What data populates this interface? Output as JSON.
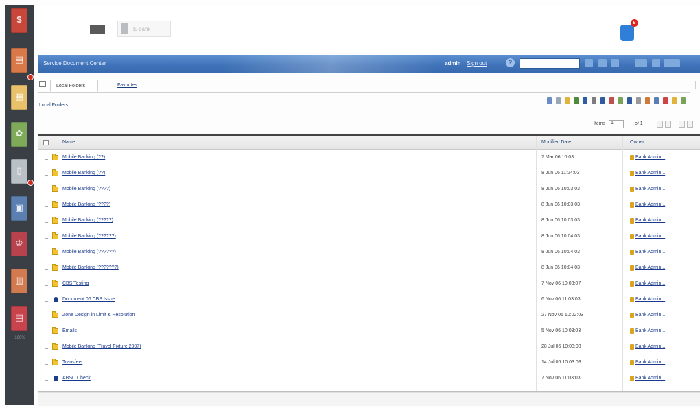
{
  "colors": {
    "dock_bg": "#3a3f46",
    "blue_bar": "#3f72b8",
    "link": "#1a3a8c",
    "badge": "#d0291b"
  },
  "dock": {
    "tiles": [
      {
        "name": "dock-tile-1",
        "color": "#c9463a",
        "glyph": "$"
      },
      {
        "name": "dock-tile-2",
        "color": "#d9794a",
        "glyph": "▤"
      },
      {
        "name": "dock-tile-3",
        "color": "#e9c16a",
        "glyph": "▦"
      },
      {
        "name": "dock-tile-4",
        "color": "#7faa5a",
        "glyph": "✿"
      },
      {
        "name": "dock-tile-5",
        "color": "#b9c1c7",
        "glyph": "▯"
      },
      {
        "name": "dock-tile-6",
        "color": "#5b7fb0",
        "glyph": "▣"
      },
      {
        "name": "dock-tile-7",
        "color": "#b9434c",
        "glyph": "♔"
      },
      {
        "name": "dock-tile-8",
        "color": "#d27a50",
        "glyph": "▥"
      },
      {
        "name": "dock-tile-9",
        "color": "#c8434c",
        "glyph": "▤"
      }
    ],
    "label": "100%"
  },
  "header": {
    "doc_label": "E-bank",
    "notification_count": "9"
  },
  "bluebar": {
    "site_name": "Service Document Center",
    "user_name": "admin",
    "user_link": "Sign out",
    "search_placeholder": ""
  },
  "tabs": [
    {
      "label": "Local Folders",
      "active": true
    },
    {
      "label": "Favorites",
      "active": false
    }
  ],
  "breadcrumb": "Local Folders",
  "pager": {
    "label": "Items",
    "value": "1",
    "of_text": "of 1"
  },
  "table": {
    "columns": {
      "name": "Name",
      "modified": "Modified Date",
      "owner": "Owner"
    },
    "rows": [
      {
        "icon": "folder",
        "name": "Mobile Banking (??)",
        "date": "7 Mar 06 10:03",
        "owner": "Bank Admin..."
      },
      {
        "icon": "folder",
        "name": "Mobile Banking (??)",
        "date": "8 Jun 06 11:24:03",
        "owner": "Bank Admin..."
      },
      {
        "icon": "folder",
        "name": "Mobile Banking (????)",
        "date": "8 Jun 06 10:03:03",
        "owner": "Bank Admin..."
      },
      {
        "icon": "folder",
        "name": "Mobile Banking (????)",
        "date": "8 Jun 06 10:03:03",
        "owner": "Bank Admin..."
      },
      {
        "icon": "folder",
        "name": "Mobile Banking (?????)",
        "date": "8 Jun 06 10:03:03",
        "owner": "Bank Admin..."
      },
      {
        "icon": "folder",
        "name": "Mobile Banking (??????)",
        "date": "8 Jun 06 10:04:03",
        "owner": "Bank Admin..."
      },
      {
        "icon": "folder",
        "name": "Mobile Banking (??????)",
        "date": "8 Jun 06 10:04:03",
        "owner": "Bank Admin..."
      },
      {
        "icon": "folder",
        "name": "Mobile Banking (???????)",
        "date": "8 Jun 06 10:04:03",
        "owner": "Bank Admin..."
      },
      {
        "icon": "folder",
        "name": "CBS Testing",
        "date": "7 Nov 06 10:03:07",
        "owner": "Bank Admin..."
      },
      {
        "icon": "doc",
        "name": "Document 06 CBS Issue",
        "date": "6 Nov 06 11:03:03",
        "owner": "Bank Admin..."
      },
      {
        "icon": "folder",
        "name": "Zone Design in Limit & Resolution",
        "date": "27 Nov 06 10:02:03",
        "owner": "Bank Admin..."
      },
      {
        "icon": "folder",
        "name": "Emails",
        "date": "5 Nov 06 10:03:03",
        "owner": "Bank Admin..."
      },
      {
        "icon": "folder",
        "name": "Mobile Banking (Travel Fixture 2007)",
        "date": "28 Jul 06 10:03:03",
        "owner": "Bank Admin..."
      },
      {
        "icon": "folder",
        "name": "Transfers",
        "date": "14 Jul 06 10:03:03",
        "owner": "Bank Admin..."
      },
      {
        "icon": "doc",
        "name": "ABSC Check",
        "date": "7 Nov 06 11:03:03",
        "owner": "Bank Admin..."
      }
    ]
  }
}
